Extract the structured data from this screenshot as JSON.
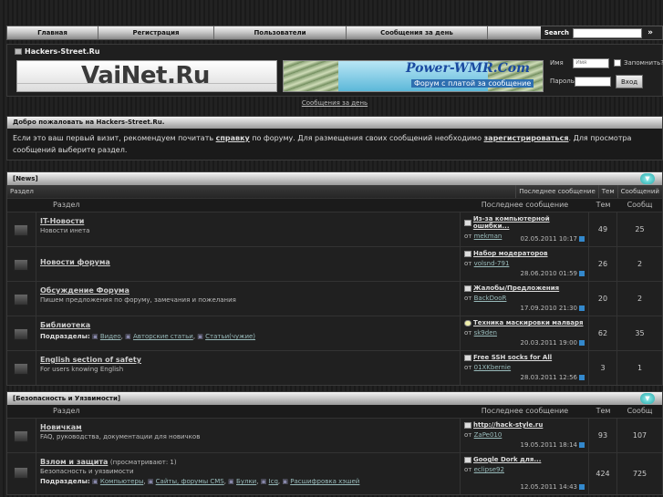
{
  "nav": {
    "items": [
      "Главная",
      "Регистрация",
      "Пользователи",
      "Сообщения за день"
    ],
    "search_label": "Search",
    "search_go": "»"
  },
  "header": {
    "site_title": "Hackers-Street.Ru",
    "banner1_text": "VaiNet.Ru",
    "banner2_title": "Power-WMR.Com",
    "banner2_sub": "Форум с платой за сообщение"
  },
  "login": {
    "name_label": "Имя",
    "name_placeholder": "Имя",
    "remember_label": "Запомнить?",
    "password_label": "Пароль",
    "submit_label": "Вход"
  },
  "today_link": "Сообщения за день",
  "welcome": {
    "title": "Добро пожаловать на Hackers-Street.Ru.",
    "text1": "Если это ваш первый визит, рекомендуем почитать ",
    "link1": "справку",
    "text2": " по форуму. Для размещения своих сообщений необходимо ",
    "link2": "зарегистрироваться",
    "text3": ". Для просмотра сообщений выберите раздел."
  },
  "cat1": {
    "title": "[News]",
    "subhead": [
      "Раздел",
      "Последнее сообщение",
      "Тем",
      "Сообщений"
    ],
    "colhead": [
      "Раздел",
      "Последнее сообщение",
      "Тем",
      "Сообщ"
    ],
    "forums": [
      {
        "name": "IT-Новости",
        "desc": "Новости инета",
        "last_title": "Из-за компьютерной ошибки...",
        "by": "от",
        "author": "mekman",
        "date": "02.05.2011 10:17",
        "topics": "49",
        "posts": "25"
      },
      {
        "name": "Новости форума",
        "desc": "",
        "last_title": "Набор модераторов",
        "by": "от",
        "author": "volsnd-791",
        "date": "28.06.2010 01:59",
        "topics": "26",
        "posts": "2"
      },
      {
        "name": "Обсуждение Форума",
        "desc": "Пишем предложения по форуму, замечания и пожелания",
        "last_title": "Жалобы/Предложения",
        "by": "от",
        "author": "BackDooR",
        "date": "17.09.2010 21:30",
        "topics": "20",
        "posts": "2"
      },
      {
        "name": "Библиотека",
        "desc": "",
        "sub_label": "Подразделы:",
        "subs": [
          "Видео",
          "Авторские статьи",
          "Статьи(чужие)"
        ],
        "last_title": "Техника маскировки малваря",
        "by": "от",
        "author": "sk9den",
        "date": "20.03.2011 19:00",
        "topics": "62",
        "posts": "35"
      },
      {
        "name": "English section of safety",
        "desc": "For users knowing English",
        "last_title": "Free SSH socks for All",
        "by": "от",
        "author": "01XKbernie",
        "date": "28.03.2011 12:56",
        "topics": "3",
        "posts": "1"
      }
    ]
  },
  "cat2": {
    "title": "[Безопасность и Уязвимости]",
    "colhead": [
      "Раздел",
      "Последнее сообщение",
      "Тем",
      "Сообщ"
    ],
    "forums": [
      {
        "name": "Новичкам",
        "desc": "FAQ, руководства, документации для новичков",
        "last_title": "http://hack-style.ru",
        "by": "от",
        "author": "ZaPe010",
        "date": "19.05.2011 18:14",
        "topics": "93",
        "posts": "107"
      },
      {
        "name": "Взлом и защита",
        "viewing": "(просматривают: 1)",
        "desc": "Безопасность и уязвимости",
        "sub_label": "Подразделы:",
        "subs": [
          "Компьютеры",
          "Сайты, форумы CMS",
          "Булки",
          "Icq",
          "Расшифровка хэшей"
        ],
        "last_title": "Google Dork для...",
        "by": "от",
        "author": "eclipse92",
        "date": "12.05.2011 14:43",
        "topics": "424",
        "posts": "725"
      }
    ]
  }
}
